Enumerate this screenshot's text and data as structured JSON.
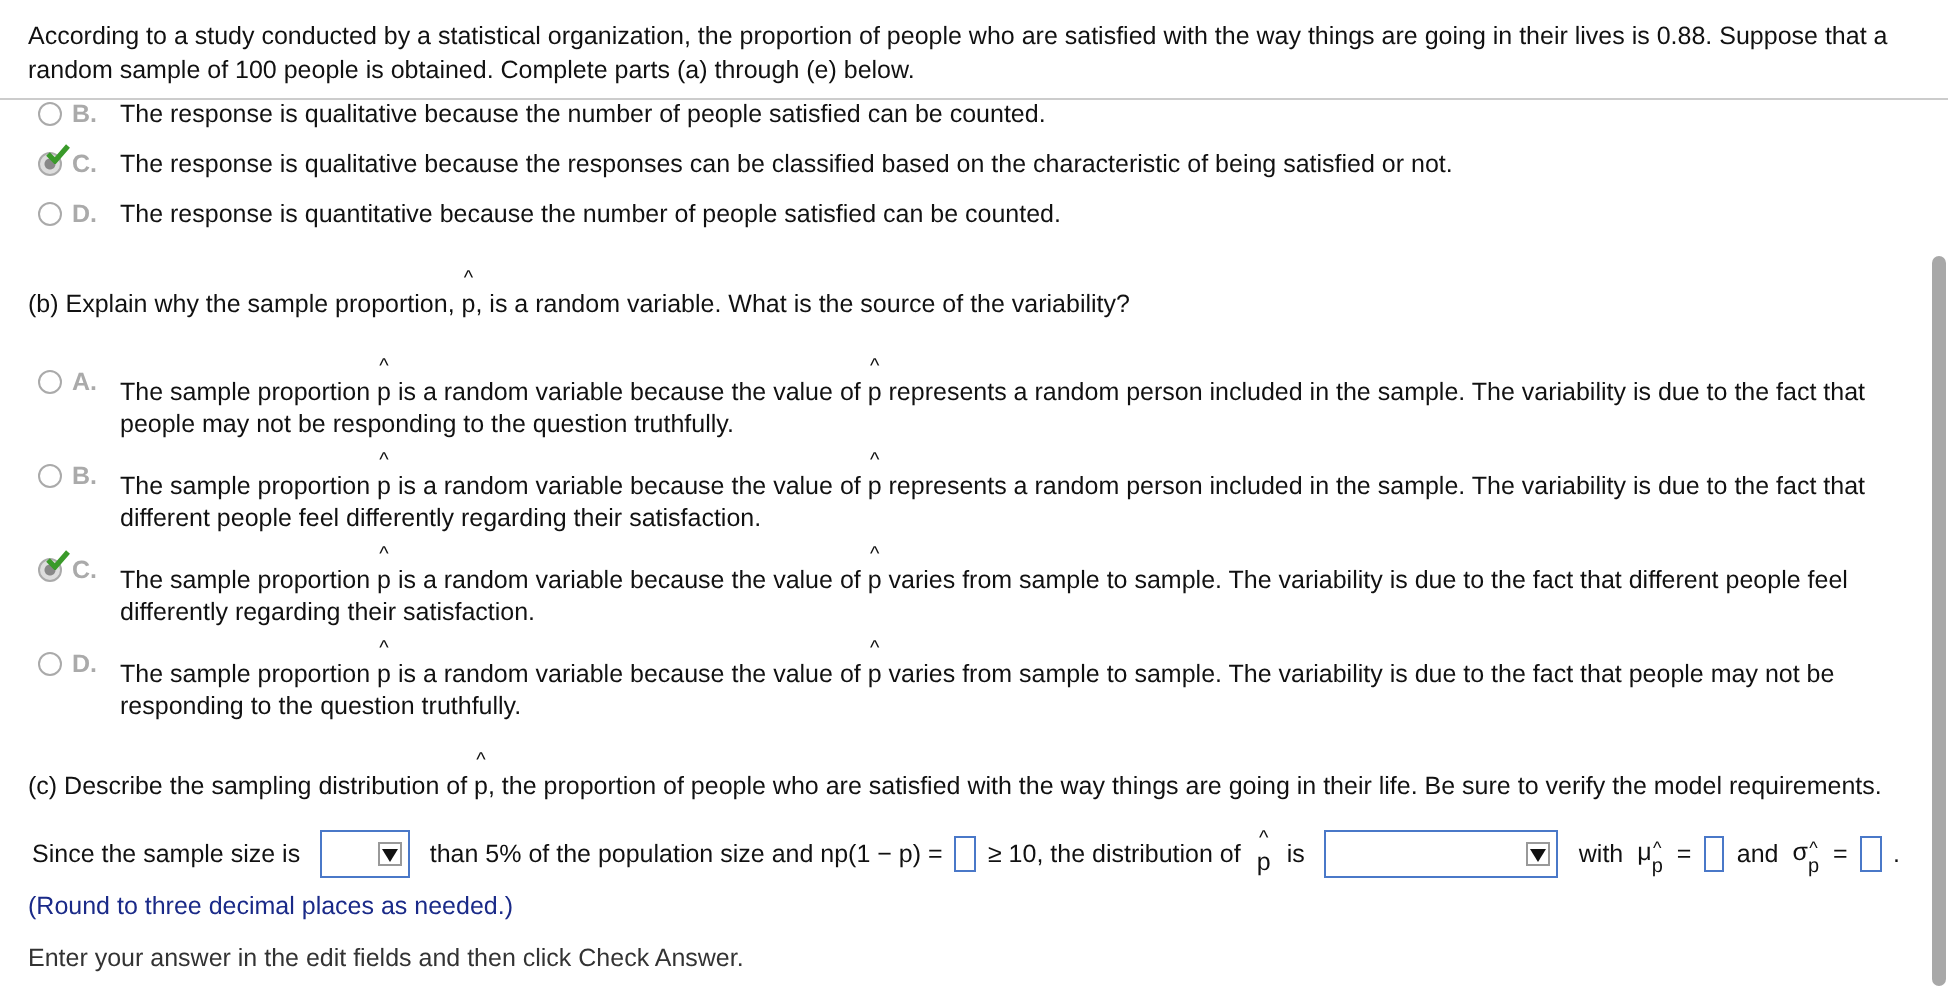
{
  "header": {
    "text": "According to a study conducted by a statistical organization, the proportion of people who are satisfied with the way things are going in their lives is 0.88. Suppose that a random sample of 100 people is obtained. Complete parts (a) through (e) below."
  },
  "part_a": {
    "options": [
      {
        "letter": "B.",
        "selected": false,
        "segments": [
          {
            "kind": "text",
            "text": "The response is qualitative because the number of people satisfied can be counted."
          }
        ]
      },
      {
        "letter": "C.",
        "selected": true,
        "segments": [
          {
            "kind": "text",
            "text": "The response is qualitative because the responses can be classified based on the characteristic of being satisfied or not."
          }
        ]
      },
      {
        "letter": "D.",
        "selected": false,
        "segments": [
          {
            "kind": "text",
            "text": "The response is quantitative because the number of people satisfied can be counted."
          }
        ]
      }
    ]
  },
  "part_b": {
    "question": [
      {
        "kind": "text",
        "text": "(b) Explain why the sample proportion, "
      },
      {
        "kind": "phat",
        "base": "p",
        "hat": "^"
      },
      {
        "kind": "text",
        "text": ", is a random variable. What is the source of the variability?"
      }
    ],
    "options": [
      {
        "letter": "A.",
        "selected": false,
        "segments": [
          {
            "kind": "text",
            "text": "The sample proportion "
          },
          {
            "kind": "phat",
            "base": "p",
            "hat": "^"
          },
          {
            "kind": "text",
            "text": " is a random variable because the value of "
          },
          {
            "kind": "phat",
            "base": "p",
            "hat": "^"
          },
          {
            "kind": "text",
            "text": " represents a random person included in the sample. The variability is due to the fact that people may not be responding to the question truthfully."
          }
        ]
      },
      {
        "letter": "B.",
        "selected": false,
        "segments": [
          {
            "kind": "text",
            "text": "The sample proportion "
          },
          {
            "kind": "phat",
            "base": "p",
            "hat": "^"
          },
          {
            "kind": "text",
            "text": " is a random variable because the value of "
          },
          {
            "kind": "phat",
            "base": "p",
            "hat": "^"
          },
          {
            "kind": "text",
            "text": " represents a random person included in the sample. The variability is due to the fact that different people feel differently regarding their satisfaction."
          }
        ]
      },
      {
        "letter": "C.",
        "selected": true,
        "segments": [
          {
            "kind": "text",
            "text": "The sample proportion "
          },
          {
            "kind": "phat",
            "base": "p",
            "hat": "^"
          },
          {
            "kind": "text",
            "text": " is a random variable because the value of "
          },
          {
            "kind": "phat",
            "base": "p",
            "hat": "^"
          },
          {
            "kind": "text",
            "text": " varies from sample to sample. The variability is due to the fact that different people feel differently regarding their satisfaction."
          }
        ]
      },
      {
        "letter": "D.",
        "selected": false,
        "segments": [
          {
            "kind": "text",
            "text": "The sample proportion "
          },
          {
            "kind": "phat",
            "base": "p",
            "hat": "^"
          },
          {
            "kind": "text",
            "text": " is a random variable because the value of "
          },
          {
            "kind": "phat",
            "base": "p",
            "hat": "^"
          },
          {
            "kind": "text",
            "text": " varies from sample to sample. The variability is due to the fact that people may not be responding to the question truthfully."
          }
        ]
      }
    ]
  },
  "part_c": {
    "question": [
      {
        "kind": "text",
        "text": "(c) Describe the sampling distribution of "
      },
      {
        "kind": "phat",
        "base": "p",
        "hat": "^"
      },
      {
        "kind": "text",
        "text": ", the proportion of people who are satisfied with the way things are going in their life. Be sure to verify the model requirements."
      }
    ],
    "answer_row": [
      {
        "kind": "text",
        "text": "Since the sample size is"
      },
      {
        "kind": "smalldropdown"
      },
      {
        "kind": "text",
        "text": "than 5% of the population size and np(1 − p) ="
      },
      {
        "kind": "box"
      },
      {
        "kind": "text",
        "text": "≥ 10, the distribution of"
      },
      {
        "kind": "phat",
        "base": "p",
        "hat": "^"
      },
      {
        "kind": "text",
        "text": "is"
      },
      {
        "kind": "dropdown"
      },
      {
        "kind": "text",
        "text": "with"
      },
      {
        "kind": "sym",
        "base": "μ",
        "sub": "p",
        "hat": "^"
      },
      {
        "kind": "text",
        "text": "="
      },
      {
        "kind": "box"
      },
      {
        "kind": "text",
        "text": "and"
      },
      {
        "kind": "sym",
        "base": "σ",
        "sub": "p",
        "hat": "^"
      },
      {
        "kind": "text",
        "text": "="
      },
      {
        "kind": "box"
      },
      {
        "kind": "text",
        "text": "."
      }
    ],
    "note": "(Round to three decimal places as needed.)"
  },
  "footer": {
    "text": "Enter your answer in the edit fields and then click Check Answer."
  }
}
